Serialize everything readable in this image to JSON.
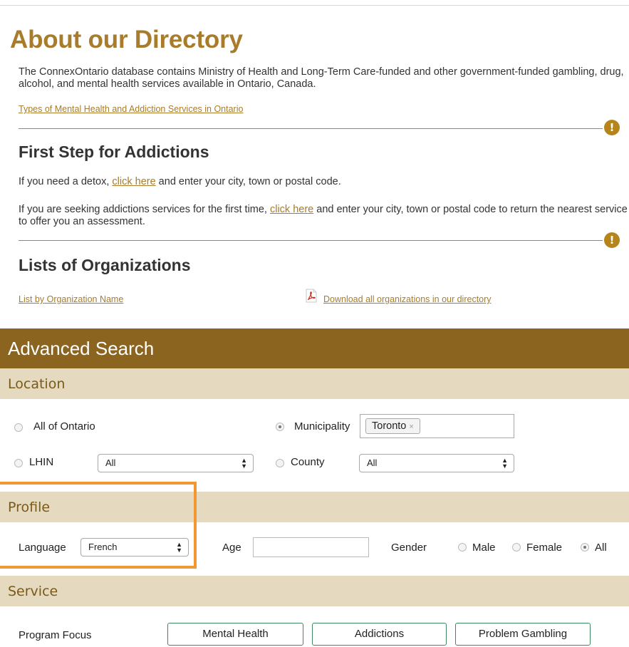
{
  "about": {
    "title": "About our Directory",
    "intro": "The ConnexOntario database contains Ministry of Health and Long-Term Care-funded and other government-funded gambling, drug, alcohol, and mental health services available in Ontario, Canada.",
    "types_link": "Types of Mental Health and Addiction Services in Ontario"
  },
  "first_step": {
    "heading": "First Step for Addictions",
    "detox_before": "If you need a detox, ",
    "detox_link": "click here",
    "detox_after": " and enter your city, town or postal code.",
    "seeking_before": "If you are seeking addictions services for the first time, ",
    "seeking_link": "click here",
    "seeking_after": " and enter your city, town or postal code to return the nearest service to offer you an assessment."
  },
  "lists": {
    "heading": "Lists of Organizations",
    "by_name_link": "List by Organization Name",
    "download_link": "Download all organizations in our directory"
  },
  "advanced_search": {
    "title": "Advanced Search",
    "location": {
      "heading": "Location",
      "all_ontario_label": "All of Ontario",
      "municipality_label": "Municipality",
      "municipality_tag": "Toronto",
      "tag_remove": "×",
      "lhin_label": "LHIN",
      "lhin_value": "All",
      "county_label": "County",
      "county_value": "All",
      "selected": "Municipality"
    },
    "profile": {
      "heading": "Profile",
      "language_label": "Language",
      "language_value": "French",
      "age_label": "Age",
      "age_value": "",
      "gender_label": "Gender",
      "gender_options": [
        "Male",
        "Female",
        "All"
      ],
      "gender_selected": "All"
    },
    "service": {
      "heading": "Service",
      "program_focus_label": "Program Focus",
      "focus_options": [
        "Mental Health",
        "Addictions",
        "Problem Gambling"
      ]
    }
  },
  "colors": {
    "title_gold": "#a87c2a",
    "band_brown": "#8b6420",
    "subhead_tan": "#e5d9bf",
    "highlight_orange": "#f29833",
    "button_border_green": "#3b8a5e"
  },
  "icons": {
    "alert": "exclamation-circle-icon",
    "pdf": "pdf-file-icon",
    "select_arrows": "up-down-arrows-icon"
  }
}
